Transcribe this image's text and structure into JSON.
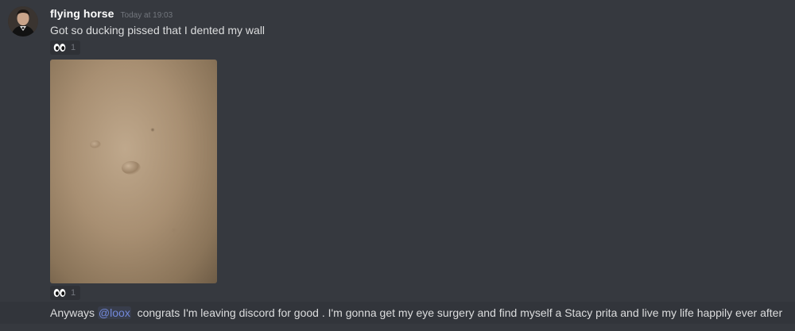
{
  "message_group": {
    "username": "flying horse",
    "timestamp": "Today at 19:03",
    "avatar_icon": "user-avatar"
  },
  "messages": [
    {
      "text": "Got so ducking pissed that I dented my wall",
      "reaction": {
        "emoji": "eyes",
        "count": "1"
      }
    },
    {
      "attachment": "dented-wall-photo",
      "reaction": {
        "emoji": "eyes",
        "count": "1"
      }
    },
    {
      "text_before_mention": "Anyways ",
      "mention": "@loox",
      "text_after_mention": "  congrats I'm leaving discord for good . I'm gonna get my eye surgery and find myself a Stacy prita and live my life happily ever after"
    }
  ],
  "colors": {
    "background": "#36393f",
    "username": "#ffffff",
    "timestamp": "#72767d",
    "message_text": "#dcddde",
    "mention": "#7289da",
    "reaction_bg": "#2f3136"
  }
}
